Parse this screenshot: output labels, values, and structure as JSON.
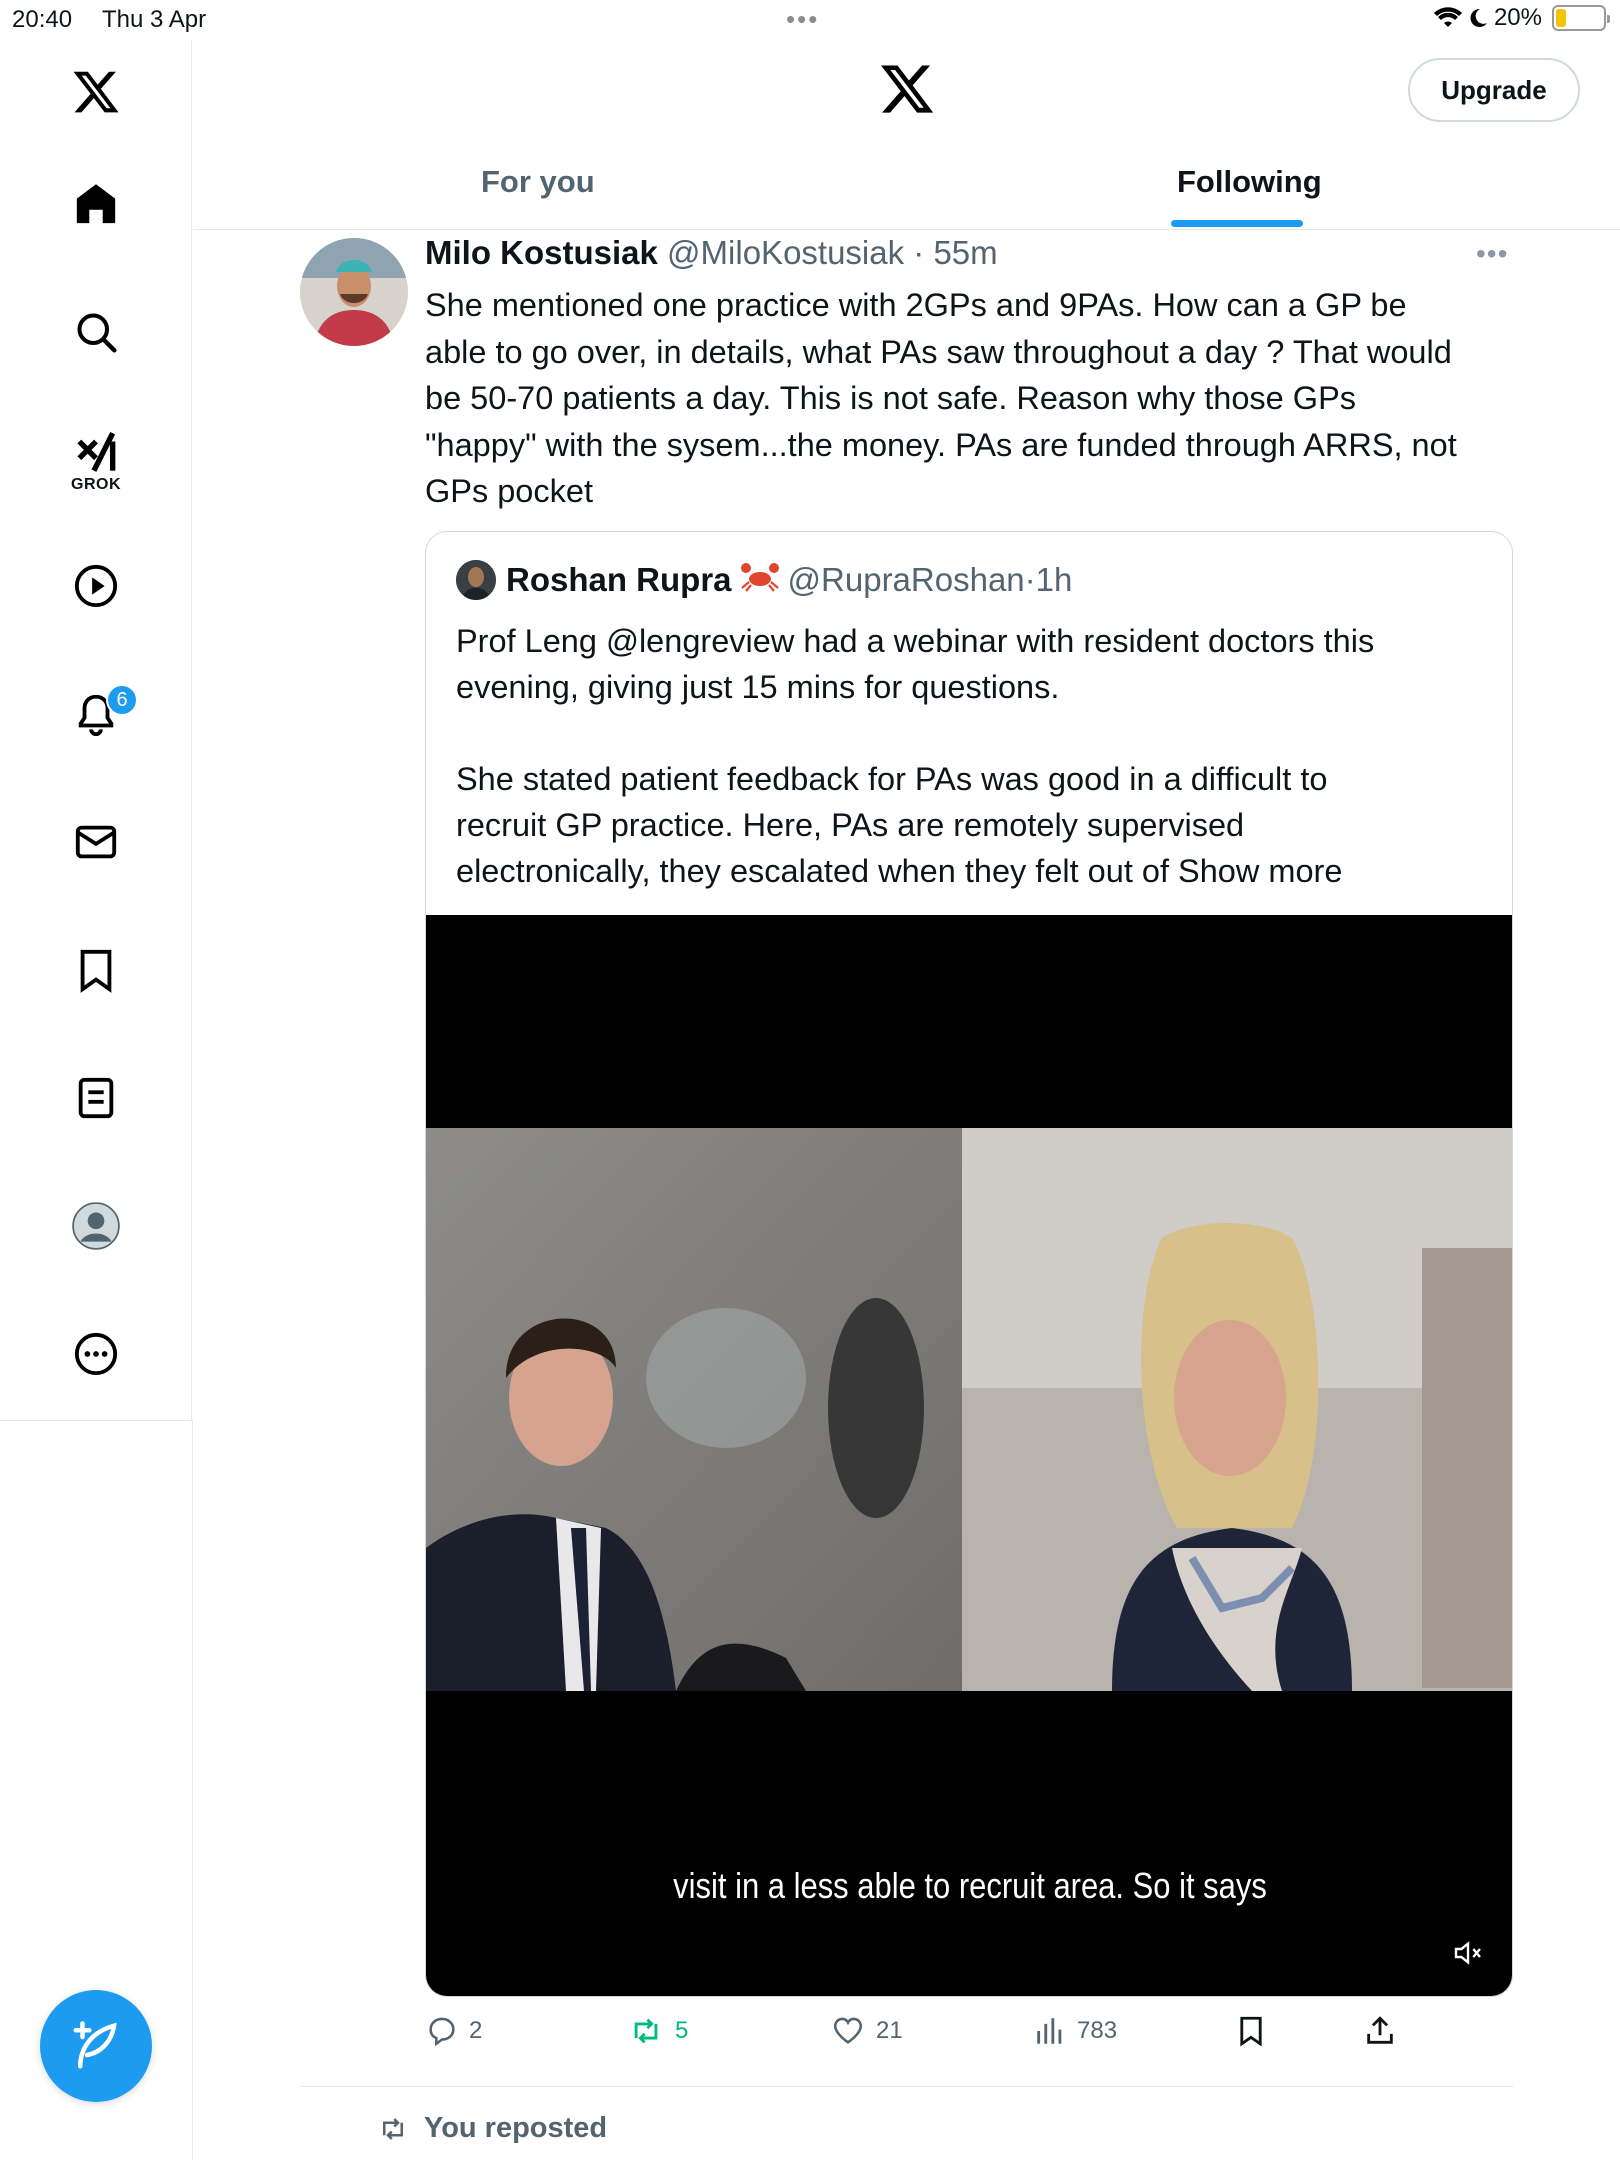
{
  "status_bar": {
    "time": "20:40",
    "date": "Thu 3 Apr",
    "battery_percent": "20%",
    "battery_level": 0.2
  },
  "sidebar": {
    "items": [
      {
        "name": "x-logo",
        "icon": "x-logo-icon"
      },
      {
        "name": "home",
        "icon": "home-icon"
      },
      {
        "name": "search",
        "icon": "search-icon"
      },
      {
        "name": "grok",
        "icon": "grok-icon",
        "label": "GROK"
      },
      {
        "name": "video",
        "icon": "play-icon"
      },
      {
        "name": "notifications",
        "icon": "bell-icon",
        "badge": "6"
      },
      {
        "name": "messages",
        "icon": "mail-icon"
      },
      {
        "name": "bookmarks",
        "icon": "bookmark-icon"
      },
      {
        "name": "lists",
        "icon": "list-icon"
      },
      {
        "name": "profile",
        "icon": "profile-icon"
      },
      {
        "name": "more",
        "icon": "more-icon"
      }
    ],
    "compose_icon": "compose-icon"
  },
  "header": {
    "upgrade_label": "Upgrade",
    "tabs": [
      {
        "label": "For you",
        "active": false
      },
      {
        "label": "Following",
        "active": true
      }
    ]
  },
  "tweet": {
    "author_name": "Milo Kostusiak",
    "author_handle": "@MiloKostusiak",
    "time": "55m",
    "text_lines": [
      "She mentioned one practice with 2GPs and 9PAs. How can a GP be",
      "able to go over, in details, what PAs saw throughout a day ? That would",
      "be 50-70 patients a day. This is not safe. Reason why those GPs",
      "\"happy\" with the sysem...the money. PAs are funded through ARRS, not",
      "GPs pocket"
    ],
    "quote": {
      "author_name": "Roshan Rupra",
      "author_emoji": "🦀",
      "author_handle": "@RupraRoshan",
      "time": "1h",
      "text_lines": [
        "Prof Leng @lengreview had a webinar with resident doctors this",
        "evening, giving just 15 mins for questions.",
        "",
        "She stated patient feedback for PAs was good in a difficult to",
        "recruit GP practice. Here, PAs are remotely supervised",
        "electronically, they escalated when they felt out of"
      ],
      "show_more": "Show more",
      "video_caption": "visit in a less able to recruit area. So it says"
    },
    "actions": {
      "replies": "2",
      "reposts": "5",
      "likes": "21",
      "views": "783"
    }
  },
  "next_item": {
    "reposted_label": "You reposted"
  },
  "colors": {
    "accent": "#1d9bf0",
    "repost_green": "#00ba7c",
    "secondary_text": "#536471",
    "border": "#cfd9de"
  }
}
